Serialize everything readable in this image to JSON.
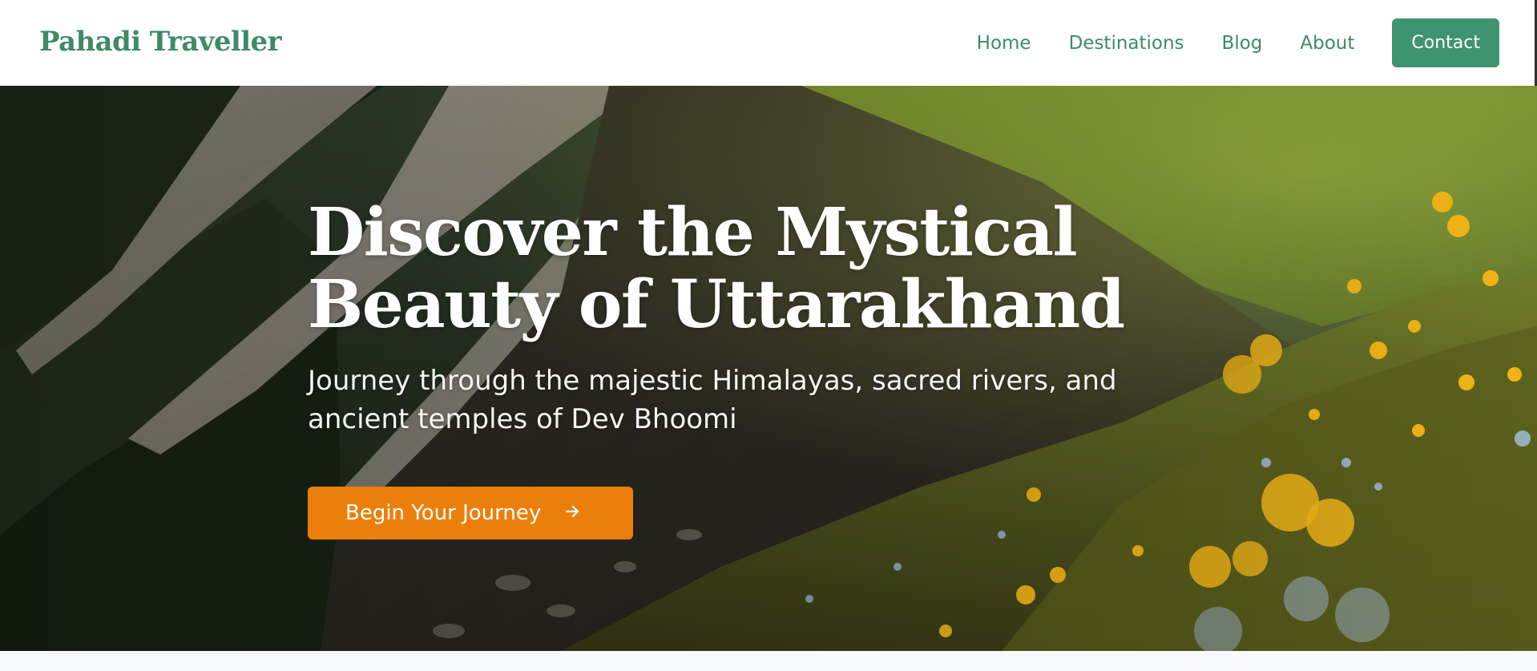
{
  "header": {
    "brand": "Pahadi Traveller",
    "nav": {
      "home": "Home",
      "destinations": "Destinations",
      "blog": "Blog",
      "about": "About",
      "contact": "Contact"
    }
  },
  "hero": {
    "title_line1": "Discover the Mystical",
    "title_line2": "Beauty of Uttarakhand",
    "subtitle": "Journey through the majestic Himalayas, sacred rivers, and ancient temples of Dev Bhoomi",
    "cta_label": "Begin Your Journey",
    "cta_icon": "arrow-right-icon"
  },
  "colors": {
    "brand_green": "#3e8b66",
    "contact_button": "#3f9470",
    "cta_orange": "#ec7f0a",
    "hero_text": "#ffffff"
  }
}
